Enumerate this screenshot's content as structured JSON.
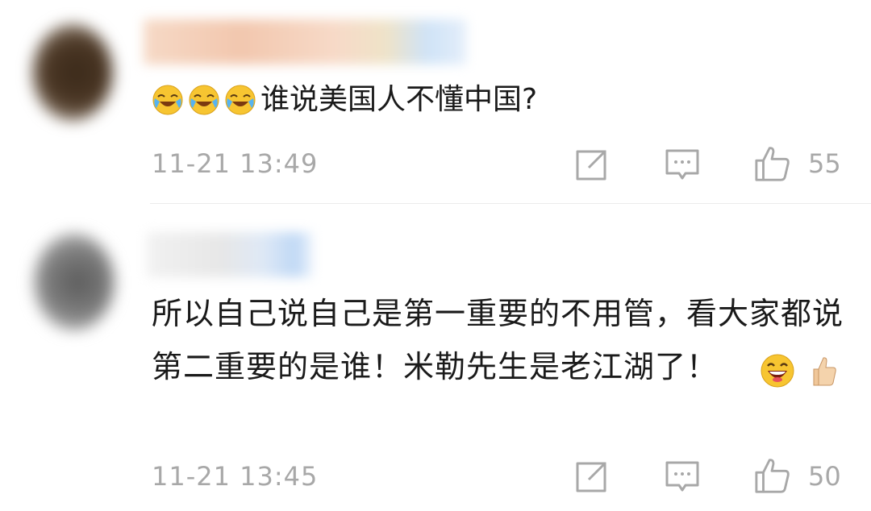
{
  "comments": [
    {
      "text": "谁说美国人不懂中国?",
      "leading_emojis": [
        "cry-laugh-emoji",
        "cry-laugh-emoji",
        "cry-laugh-emoji"
      ],
      "time": "11-21 13:49",
      "likes": "55"
    },
    {
      "text": "所以自己说自己是第一重要的不用管，看大家都说第二重要的是谁！米勒先生是老江湖了！",
      "trailing_emojis": [
        "grin-emoji",
        "thumbs-up-emoji"
      ],
      "time": "11-21 13:45",
      "likes": "50"
    }
  ],
  "icons": {
    "share": "share-icon",
    "reply": "comment-icon",
    "like": "thumbs-up-icon"
  },
  "colors": {
    "text": "#1a1a1a",
    "meta": "#a8a8a8",
    "divider": "#ececec",
    "emoji_yellow": "#f7c531"
  }
}
